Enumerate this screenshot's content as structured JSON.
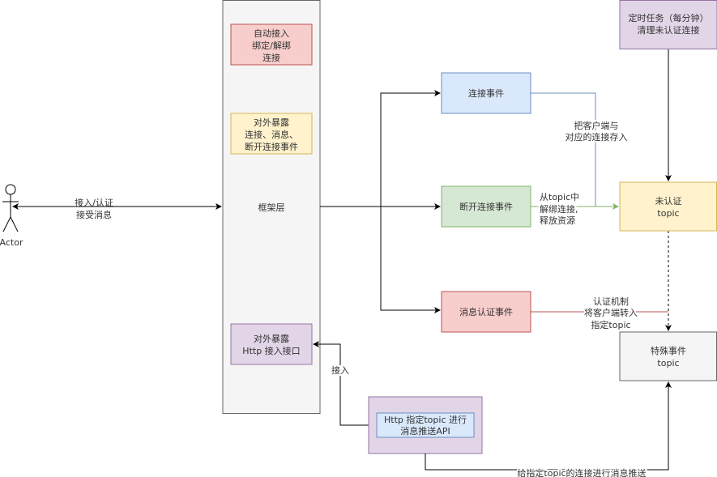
{
  "actor": {
    "label": "Actor"
  },
  "framework": {
    "label": "框架层"
  },
  "actor_link": {
    "lines": [
      "接入/认证",
      "接受消息"
    ]
  },
  "left_boxes": [
    {
      "lines": [
        "自动接入",
        "绑定/解绑",
        "连接"
      ],
      "fill": "#f8cecc",
      "stroke": "#b85450"
    },
    {
      "lines": [
        "对外暴露",
        "连接、消息、",
        "断开连接事件"
      ],
      "fill": "#fff2cc",
      "stroke": "#d6b656"
    },
    {
      "lines": [
        "对外暴露",
        "Http 接入接口"
      ],
      "fill": "#e1d5e7",
      "stroke": "#9673a6"
    }
  ],
  "events": [
    {
      "label": "连接事件",
      "fill": "#dae8fc",
      "stroke": "#6c8ebf"
    },
    {
      "label": "断开连接事件",
      "fill": "#d5e8d4",
      "stroke": "#82b366"
    },
    {
      "label": "消息认证事件",
      "fill": "#f8cecc",
      "stroke": "#b85450"
    }
  ],
  "topics": {
    "scheduled": {
      "lines": [
        "定时任务（每分钟）",
        "清理未认证连接"
      ]
    },
    "unauth": {
      "lines": [
        "未认证",
        "topic"
      ]
    },
    "special": {
      "lines": [
        "特殊事件",
        "topic"
      ]
    }
  },
  "edge_labels": {
    "store": [
      "把客户端与",
      "对应的连接存入"
    ],
    "unbind": [
      "从topic中",
      "解绑连接,",
      "释放资源"
    ],
    "auth": [
      "认证机制",
      "将客户端转入",
      "指定topic"
    ],
    "access": "接入",
    "push": "给指定topic的连接进行消息推送"
  },
  "http_api": {
    "lines": [
      "Http 指定topic 进行",
      "消息推送API"
    ]
  }
}
